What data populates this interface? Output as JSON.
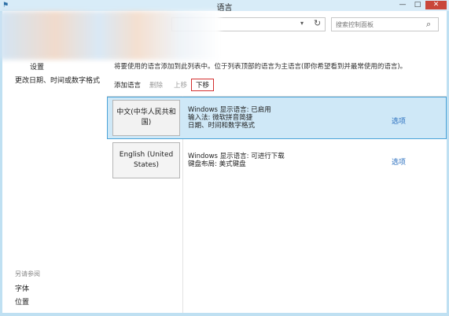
{
  "window": {
    "title": "语言",
    "minimize_glyph": "—",
    "maximize_glyph": "□",
    "close_glyph": "✕"
  },
  "address_bar": {
    "dropdown_glyph": "▾",
    "refresh_glyph": "↻"
  },
  "search": {
    "placeholder": "搜索控制面板",
    "icon_glyph": "⌕"
  },
  "nav": {
    "items": [
      "设置",
      "更改日期、时间或数字格式"
    ],
    "see_also_heading": "另请参阅",
    "see_also_items": [
      "字体",
      "位置"
    ]
  },
  "main": {
    "description": "将要使用的语言添加到此列表中。位于列表顶部的语言为主语言(即你希望看到并最常使用的语言)。",
    "toolbar": {
      "add_label": "添加语言",
      "remove_label": "删除",
      "move_up_label": "上移",
      "move_down_label": "下移"
    },
    "languages": [
      {
        "name": "中文(中华人民共和国)",
        "details": [
          "Windows 显示语言: 已启用",
          "输入法: 微软拼音简捷",
          "日期、时间和数字格式"
        ],
        "options_label": "选项"
      },
      {
        "name": "English (United States)",
        "details": [
          "Windows 显示语言: 可进行下载",
          "键盘布局: 美式键盘"
        ],
        "options_label": "选项"
      }
    ]
  },
  "colors": {
    "selected_row": "#cfe8f7",
    "selected_border": "#4aa3d8",
    "link": "#2a6fbf",
    "highlight_box": "#d32f2f"
  },
  "icons": {
    "app": "language-icon",
    "search": "search-icon",
    "refresh": "refresh-icon"
  }
}
